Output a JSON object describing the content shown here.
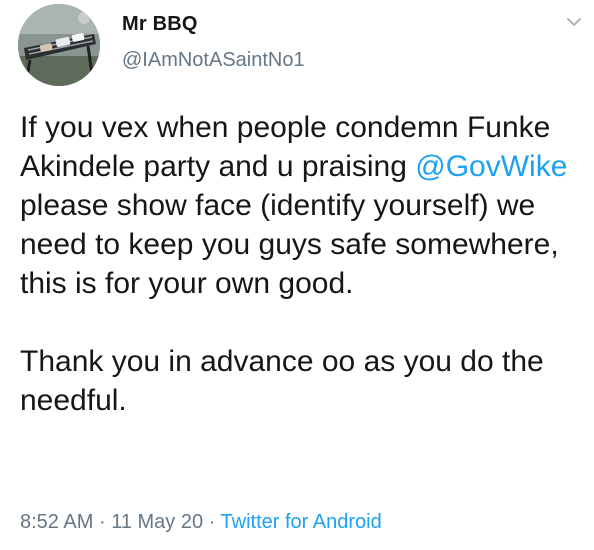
{
  "author": {
    "display_name": "Mr BBQ",
    "handle": "@IAmNotASaintNo1",
    "avatar_icon": "bbq-grill-photo"
  },
  "menu": {
    "icon": "chevron-down-icon"
  },
  "tweet": {
    "paragraph1_before": "If you vex when people condemn Funke Akindele party and u praising ",
    "mention": "@GovWike",
    "paragraph1_after": " please show face (identify yourself) we need to keep you guys safe somewhere, this is for your own good.",
    "paragraph2": "Thank you in advance oo as you do the needful."
  },
  "meta": {
    "time": "8:52 AM",
    "separator": "·",
    "date": "11 May 20",
    "source": "Twitter for Android"
  },
  "colors": {
    "accent": "#1da1f2",
    "text": "#14171a",
    "secondary": "#657786"
  }
}
